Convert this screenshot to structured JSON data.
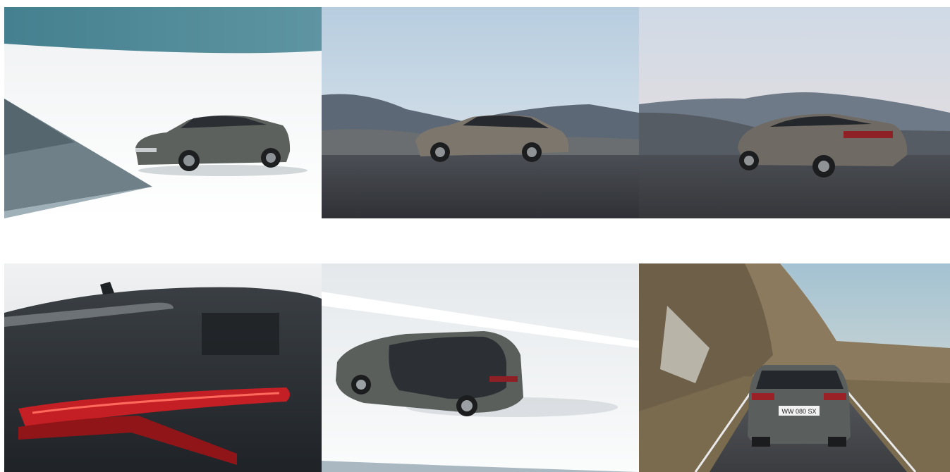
{
  "gallery": {
    "images": [
      {
        "subject": "car-studio-front-three-quarter",
        "colors": {
          "wall": "#f2f4f5",
          "ceiling": "#4f8795",
          "car": "#5b5f5c"
        }
      },
      {
        "subject": "car-side-mountain-dusk",
        "colors": {
          "sky": "#c8d8e4",
          "ground": "#3b3d42",
          "car": "#7a736a"
        }
      },
      {
        "subject": "car-rear-three-quarter-mountain",
        "colors": {
          "sky": "#d8e0ea",
          "ground": "#3e4147",
          "car": "#6e6a63"
        }
      },
      {
        "subject": "car-taillight-detail",
        "colors": {
          "body": "#2b2f33",
          "light": "#c41f24"
        }
      },
      {
        "subject": "car-top-view-studio",
        "colors": {
          "floor": "#f4f6f7",
          "car": "#585d59"
        }
      },
      {
        "subject": "car-rear-on-mountain-road",
        "colors": {
          "sky": "#a9c7d6",
          "rock": "#8a7a62",
          "road": "#4b4e52",
          "car": "#5a5e5c"
        }
      }
    ],
    "plates": {
      "rear_plate": "WW 080 SX"
    }
  }
}
